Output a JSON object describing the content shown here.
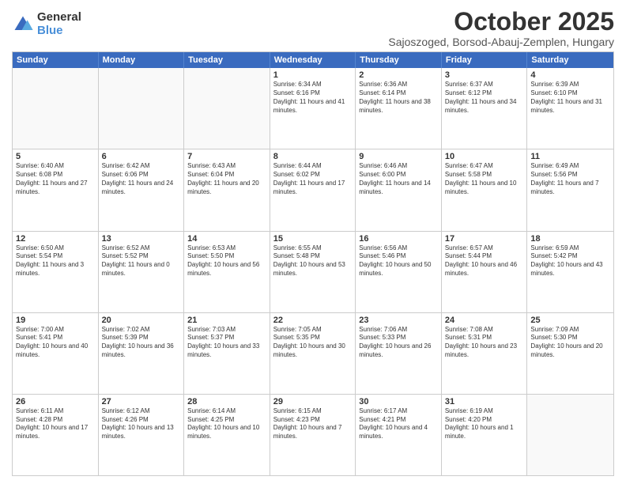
{
  "logo": {
    "general": "General",
    "blue": "Blue"
  },
  "header": {
    "month": "October 2025",
    "location": "Sajoszoged, Borsod-Abauj-Zemplen, Hungary"
  },
  "days": [
    "Sunday",
    "Monday",
    "Tuesday",
    "Wednesday",
    "Thursday",
    "Friday",
    "Saturday"
  ],
  "weeks": [
    [
      {
        "day": "",
        "text": ""
      },
      {
        "day": "",
        "text": ""
      },
      {
        "day": "",
        "text": ""
      },
      {
        "day": "1",
        "text": "Sunrise: 6:34 AM\nSunset: 6:16 PM\nDaylight: 11 hours and 41 minutes."
      },
      {
        "day": "2",
        "text": "Sunrise: 6:36 AM\nSunset: 6:14 PM\nDaylight: 11 hours and 38 minutes."
      },
      {
        "day": "3",
        "text": "Sunrise: 6:37 AM\nSunset: 6:12 PM\nDaylight: 11 hours and 34 minutes."
      },
      {
        "day": "4",
        "text": "Sunrise: 6:39 AM\nSunset: 6:10 PM\nDaylight: 11 hours and 31 minutes."
      }
    ],
    [
      {
        "day": "5",
        "text": "Sunrise: 6:40 AM\nSunset: 6:08 PM\nDaylight: 11 hours and 27 minutes."
      },
      {
        "day": "6",
        "text": "Sunrise: 6:42 AM\nSunset: 6:06 PM\nDaylight: 11 hours and 24 minutes."
      },
      {
        "day": "7",
        "text": "Sunrise: 6:43 AM\nSunset: 6:04 PM\nDaylight: 11 hours and 20 minutes."
      },
      {
        "day": "8",
        "text": "Sunrise: 6:44 AM\nSunset: 6:02 PM\nDaylight: 11 hours and 17 minutes."
      },
      {
        "day": "9",
        "text": "Sunrise: 6:46 AM\nSunset: 6:00 PM\nDaylight: 11 hours and 14 minutes."
      },
      {
        "day": "10",
        "text": "Sunrise: 6:47 AM\nSunset: 5:58 PM\nDaylight: 11 hours and 10 minutes."
      },
      {
        "day": "11",
        "text": "Sunrise: 6:49 AM\nSunset: 5:56 PM\nDaylight: 11 hours and 7 minutes."
      }
    ],
    [
      {
        "day": "12",
        "text": "Sunrise: 6:50 AM\nSunset: 5:54 PM\nDaylight: 11 hours and 3 minutes."
      },
      {
        "day": "13",
        "text": "Sunrise: 6:52 AM\nSunset: 5:52 PM\nDaylight: 11 hours and 0 minutes."
      },
      {
        "day": "14",
        "text": "Sunrise: 6:53 AM\nSunset: 5:50 PM\nDaylight: 10 hours and 56 minutes."
      },
      {
        "day": "15",
        "text": "Sunrise: 6:55 AM\nSunset: 5:48 PM\nDaylight: 10 hours and 53 minutes."
      },
      {
        "day": "16",
        "text": "Sunrise: 6:56 AM\nSunset: 5:46 PM\nDaylight: 10 hours and 50 minutes."
      },
      {
        "day": "17",
        "text": "Sunrise: 6:57 AM\nSunset: 5:44 PM\nDaylight: 10 hours and 46 minutes."
      },
      {
        "day": "18",
        "text": "Sunrise: 6:59 AM\nSunset: 5:42 PM\nDaylight: 10 hours and 43 minutes."
      }
    ],
    [
      {
        "day": "19",
        "text": "Sunrise: 7:00 AM\nSunset: 5:41 PM\nDaylight: 10 hours and 40 minutes."
      },
      {
        "day": "20",
        "text": "Sunrise: 7:02 AM\nSunset: 5:39 PM\nDaylight: 10 hours and 36 minutes."
      },
      {
        "day": "21",
        "text": "Sunrise: 7:03 AM\nSunset: 5:37 PM\nDaylight: 10 hours and 33 minutes."
      },
      {
        "day": "22",
        "text": "Sunrise: 7:05 AM\nSunset: 5:35 PM\nDaylight: 10 hours and 30 minutes."
      },
      {
        "day": "23",
        "text": "Sunrise: 7:06 AM\nSunset: 5:33 PM\nDaylight: 10 hours and 26 minutes."
      },
      {
        "day": "24",
        "text": "Sunrise: 7:08 AM\nSunset: 5:31 PM\nDaylight: 10 hours and 23 minutes."
      },
      {
        "day": "25",
        "text": "Sunrise: 7:09 AM\nSunset: 5:30 PM\nDaylight: 10 hours and 20 minutes."
      }
    ],
    [
      {
        "day": "26",
        "text": "Sunrise: 6:11 AM\nSunset: 4:28 PM\nDaylight: 10 hours and 17 minutes."
      },
      {
        "day": "27",
        "text": "Sunrise: 6:12 AM\nSunset: 4:26 PM\nDaylight: 10 hours and 13 minutes."
      },
      {
        "day": "28",
        "text": "Sunrise: 6:14 AM\nSunset: 4:25 PM\nDaylight: 10 hours and 10 minutes."
      },
      {
        "day": "29",
        "text": "Sunrise: 6:15 AM\nSunset: 4:23 PM\nDaylight: 10 hours and 7 minutes."
      },
      {
        "day": "30",
        "text": "Sunrise: 6:17 AM\nSunset: 4:21 PM\nDaylight: 10 hours and 4 minutes."
      },
      {
        "day": "31",
        "text": "Sunrise: 6:19 AM\nSunset: 4:20 PM\nDaylight: 10 hours and 1 minute."
      },
      {
        "day": "",
        "text": ""
      }
    ]
  ]
}
